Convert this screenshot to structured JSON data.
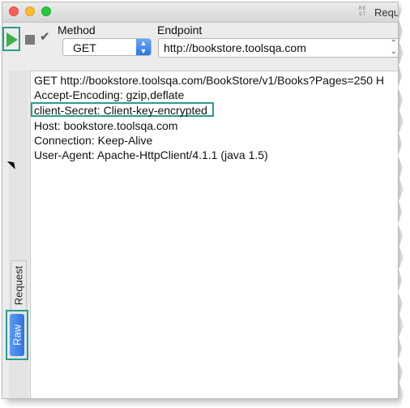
{
  "window": {
    "title": "Requ",
    "app_icon_text": "RE ST"
  },
  "toolbar": {
    "run_icon": "play-icon",
    "stop_icon": "stop-icon",
    "check_icon": "checkmark-icon",
    "method_label": "Method",
    "method_value": "GET",
    "endpoint_label": "Endpoint",
    "endpoint_value": "http://bookstore.toolsqa.com"
  },
  "side_tabs": {
    "request": "Request",
    "raw": "Raw"
  },
  "request_raw": {
    "lines": [
      "GET http://bookstore.toolsqa.com/BookStore/v1/Books?Pages=250 H",
      "Accept-Encoding: gzip,deflate",
      "client-Secret: Client-key-encrypted",
      "Host: bookstore.toolsqa.com",
      "Connection: Keep-Alive",
      "User-Agent: Apache-HttpClient/4.1.1 (java 1.5)"
    ]
  },
  "colors": {
    "highlight_border": "#2a9d8f",
    "run_green": "#3cb043",
    "raw_tab_blue": "#2f73e4"
  }
}
